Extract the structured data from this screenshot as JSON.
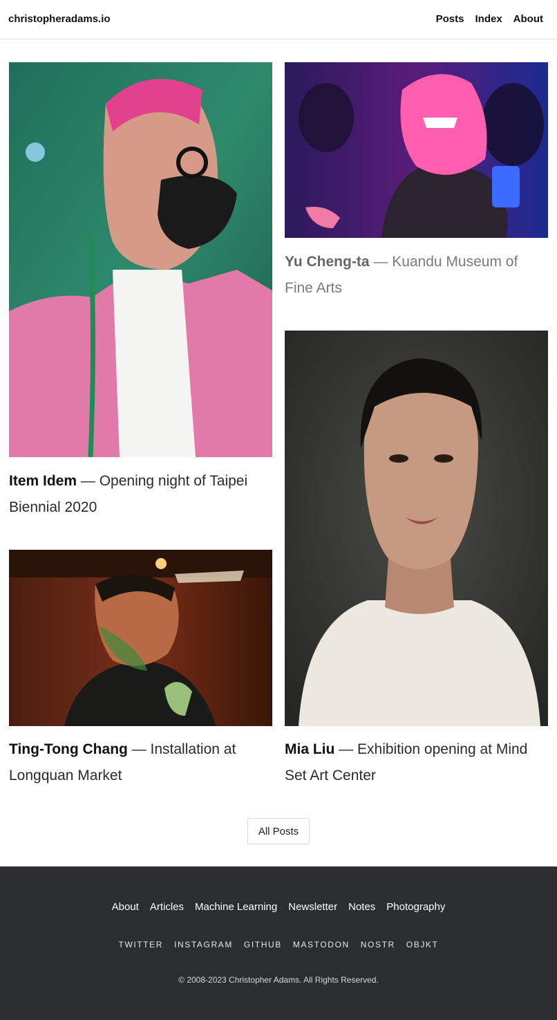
{
  "header": {
    "site_title": "christopheradams.io",
    "nav": [
      "Posts",
      "Index",
      "About"
    ]
  },
  "posts": [
    {
      "name": "Item Idem",
      "separator": " — ",
      "description": "Opening night of Taipei Biennial 2020"
    },
    {
      "name": "Yu Cheng-ta",
      "separator": " — ",
      "description": "Kuandu Museum of Fine Arts"
    },
    {
      "name": "Ting-Tong Chang",
      "separator": " — ",
      "description": "Installation at Longquan Market"
    },
    {
      "name": "Mia Liu",
      "separator": " — ",
      "description": "Exhibition opening at Mind Set Art Center"
    }
  ],
  "all_posts_label": "All Posts",
  "footer": {
    "links": [
      "About",
      "Articles",
      "Machine Learning",
      "Newsletter",
      "Notes",
      "Photography"
    ],
    "social": [
      "TWITTER",
      "INSTAGRAM",
      "GITHUB",
      "MASTODON",
      "NOSTR",
      "OBJKT"
    ],
    "copyright": "© 2008-2023 Christopher Adams. All Rights Reserved."
  },
  "colors": {
    "footer_bg": "#2b2d2f",
    "text": "#222222",
    "muted_caption": "#7a7a7a"
  }
}
